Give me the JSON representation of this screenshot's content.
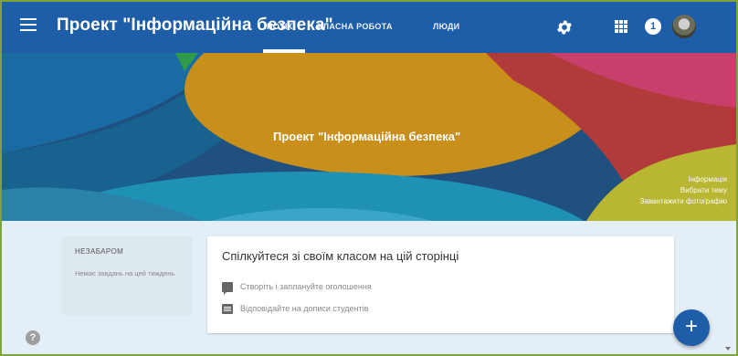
{
  "app": {
    "title": "Проект \"Інформаційна безпека\"",
    "accent_color": "#1e5da8"
  },
  "tabs": [
    {
      "label": "ПОТІК",
      "active": true
    },
    {
      "label": "КЛАСНА РОБОТА",
      "active": false
    },
    {
      "label": "ЛЮДИ",
      "active": false
    }
  ],
  "topbar_icons": {
    "menu": "menu-icon",
    "settings": "gear-icon",
    "apps": "apps-grid-icon",
    "notifications_count": "1",
    "account": "avatar"
  },
  "banner": {
    "title": "Проект \"Інформаційна безпека\"",
    "links": [
      "Інформація",
      "Вибрати тему",
      "Завантажити фотографію"
    ]
  },
  "upcoming": {
    "title": "НЕЗАБАРОМ",
    "empty_text": "Немає завдань на цей тиждень"
  },
  "main_card": {
    "title": "Спілкуйтеся зі своїм класом на цій сторінці",
    "items": [
      {
        "icon": "chat-icon",
        "text": "Створіть і заплануйте оголошення"
      },
      {
        "icon": "list-icon",
        "text": "Відповідайте на дописи студентів"
      }
    ]
  },
  "help": {
    "symbol": "?"
  },
  "fab": {
    "symbol": "+"
  }
}
